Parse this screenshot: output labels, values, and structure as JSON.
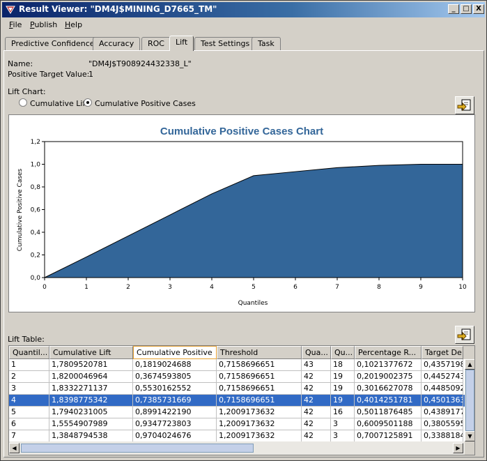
{
  "window": {
    "title": "Result Viewer: \"DM4J$MINING_D7665_TM\"",
    "controls": [
      "_",
      "□",
      "X"
    ]
  },
  "menu": [
    {
      "label": "File",
      "mnemonic": "F",
      "rest": "ile"
    },
    {
      "label": "Publish",
      "mnemonic": "P",
      "rest": "ublish"
    },
    {
      "label": "Help",
      "mnemonic": "H",
      "rest": "elp"
    }
  ],
  "tabs": [
    {
      "label": "Predictive Confidence",
      "active": false
    },
    {
      "label": "Accuracy",
      "active": false
    },
    {
      "label": "ROC",
      "active": false
    },
    {
      "label": "Lift",
      "active": true
    },
    {
      "label": "Test Settings",
      "active": false
    },
    {
      "label": "Task",
      "active": false
    }
  ],
  "info": {
    "name_label": "Name:",
    "name_value": "\"DM4J$T908924432338_L\"",
    "target_label": "Positive Target Value:",
    "target_value": "1"
  },
  "lift_chart": {
    "label": "Lift Chart:",
    "options": [
      {
        "label": "Cumulative Lift",
        "selected": false
      },
      {
        "label": "Cumulative Positive Cases",
        "selected": true
      }
    ]
  },
  "chart_data": {
    "type": "area",
    "title": "Cumulative Positive Cases Chart",
    "xlabel": "Quantiles",
    "ylabel": "Cumulative Positive Cases",
    "x": [
      0,
      1,
      2,
      3,
      4,
      5,
      6,
      7,
      8,
      9,
      10
    ],
    "values": [
      0,
      0.182,
      0.367,
      0.553,
      0.739,
      0.899,
      0.935,
      0.97,
      0.99,
      1.0,
      1.0
    ],
    "xlim": [
      0,
      10
    ],
    "ylim": [
      0,
      1.2
    ],
    "xticks": [
      "0",
      "1",
      "2",
      "3",
      "4",
      "5",
      "6",
      "7",
      "8",
      "9",
      "10"
    ],
    "yticks": [
      "0,0",
      "0,2",
      "0,4",
      "0,6",
      "0,8",
      "1,0",
      "1,2"
    ],
    "color": "#336699",
    "title_color": "#336699",
    "grid": false
  },
  "lift_table": {
    "label": "Lift Table:",
    "columns": [
      "Quantil...",
      "Cumulative Lift",
      "Cumulative Positive",
      "Threshold",
      "Qua...",
      "Qu...",
      "Percentage R...",
      "Target De"
    ],
    "rows": [
      [
        "1",
        "1,7809520781",
        "0,1819024688",
        "0,7158696651",
        "43",
        "18",
        "0,1021377672",
        "0,4357198"
      ],
      [
        "2",
        "1,8200046964",
        "0,3674593805",
        "0,7158696651",
        "42",
        "19",
        "0,2019002375",
        "0,4452743"
      ],
      [
        "3",
        "1,8332271137",
        "0,5530162552",
        "0,7158696651",
        "42",
        "19",
        "0,3016627078",
        "0,4485092"
      ],
      [
        "4",
        "1,8398775342",
        "0,7385731669",
        "0,7158696651",
        "42",
        "19",
        "0,4014251781",
        "0,4501363"
      ],
      [
        "5",
        "1,7940231005",
        "0,8991422190",
        "1,2009173632",
        "42",
        "16",
        "0,5011876485",
        "0,4389177"
      ],
      [
        "6",
        "1,5554907989",
        "0,9347723803",
        "1,2009173632",
        "42",
        "3",
        "0,6009501188",
        "0,3805595"
      ],
      [
        "7",
        "1,3848794538",
        "0,9704024676",
        "1,2009173632",
        "42",
        "3",
        "0,7007125891",
        "0,3388184"
      ]
    ],
    "selected_row": 3
  }
}
